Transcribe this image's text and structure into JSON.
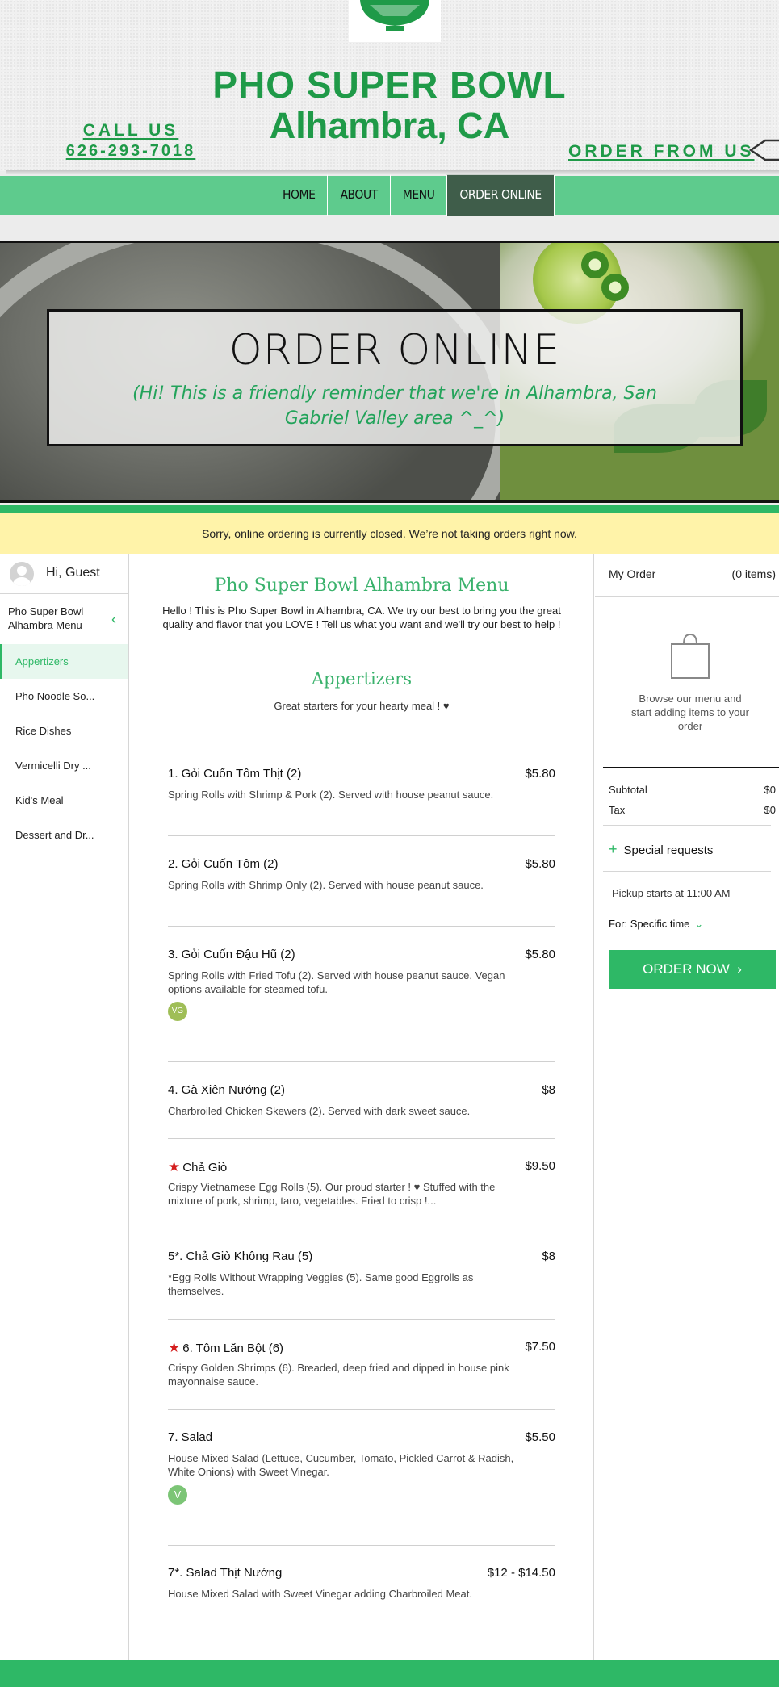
{
  "colors": {
    "brand_green": "#1f9a48",
    "nav_green": "#5ecb8d",
    "nav_active": "#3f5d4a",
    "accent": "#2eb866",
    "notice_bg": "#fff3a9",
    "star": "#d41e1e"
  },
  "header": {
    "title_line1": "PHO SUPER BOWL",
    "title_line2": "Alhambra, CA",
    "call_label": "CALL US",
    "phone": "626-293-7018",
    "order_from_label": "ORDER FROM US"
  },
  "nav": {
    "items": [
      {
        "label": "HOME"
      },
      {
        "label": "ABOUT"
      },
      {
        "label": "MENU"
      },
      {
        "label": "ORDER ONLINE"
      }
    ]
  },
  "hero": {
    "title": "ORDER ONLINE",
    "subtitle": "(Hi! This is a friendly reminder that we're in Alhambra, San Gabriel Valley area ^_^)"
  },
  "notice": "Sorry, online ordering is currently closed. We’re not taking orders right now.",
  "sidebar": {
    "greeting": "Hi, Guest",
    "menu_name": "Pho Super Bowl Alhambra Menu",
    "categories": [
      {
        "label": "Appertizers"
      },
      {
        "label": "Pho Noodle So..."
      },
      {
        "label": "Rice Dishes"
      },
      {
        "label": "Vermicelli Dry ..."
      },
      {
        "label": "Kid's Meal"
      },
      {
        "label": "Dessert and Dr..."
      }
    ]
  },
  "menu": {
    "title": "Pho Super Bowl Alhambra Menu",
    "intro": "Hello ! This is Pho Super Bowl in Alhambra, CA. We try our best to bring you the great quality and flavor that you LOVE ! Tell us what you want and we'll try our best to help !",
    "section_title": "Appertizers",
    "section_desc": "Great starters for your hearty meal ! ♥",
    "items": [
      {
        "name": "1. Gỏi Cuốn Tôm Thịt (2)",
        "price": "$5.80",
        "desc": "Spring Rolls with Shrimp & Pork (2). Served with house peanut sauce."
      },
      {
        "name": "2. Gỏi Cuốn Tôm (2)",
        "price": "$5.80",
        "desc": "Spring Rolls with Shrimp Only (2). Served with house peanut sauce."
      },
      {
        "name": "3. Gỏi Cuốn Đậu Hũ (2)",
        "price": "$5.80",
        "desc": "Spring Rolls with Fried Tofu (2). Served with house peanut sauce. Vegan options available for steamed tofu.",
        "badge": "VG"
      },
      {
        "name": "4. Gà Xiên Nướng (2)",
        "price": "$8",
        "desc": "Charbroiled Chicken Skewers (2). Served with dark sweet sauce."
      },
      {
        "name": "Chả Giò",
        "price": "$9.50",
        "desc": "Crispy Vietnamese Egg Rolls (5). Our proud starter ! ♥ Stuffed with the mixture of pork, shrimp, taro, vegetables. Fried to crisp !...",
        "starred": true
      },
      {
        "name": "5*. Chả Giò Không Rau (5)",
        "price": "$8",
        "desc": "*Egg Rolls Without Wrapping Veggies (5). Same good Eggrolls as themselves."
      },
      {
        "name": "6. Tôm Lăn Bột (6)",
        "price": "$7.50",
        "desc": "Crispy Golden Shrimps (6). Breaded, deep fried and dipped in house pink mayonnaise sauce.",
        "starred": true
      },
      {
        "name": "7. Salad",
        "price": "$5.50",
        "desc": "House Mixed Salad (Lettuce, Cucumber, Tomato, Pickled Carrot & Radish, White Onions) with Sweet Vinegar.",
        "badge": "V"
      },
      {
        "name": "7*. Salad Thịt Nướng",
        "price": "$12 - $14.50",
        "desc": "House Mixed Salad with Sweet Vinegar adding Charbroiled Meat."
      }
    ]
  },
  "cart": {
    "title": "My Order",
    "count": "(0 items)",
    "empty_text": "Browse our menu and start adding items to your order",
    "subtotal_label": "Subtotal",
    "subtotal_value": "$0",
    "tax_label": "Tax",
    "tax_value": "$0",
    "special_requests": "Special requests",
    "pickup": "Pickup starts at 11:00 AM",
    "time_option": "For: Specific time",
    "order_button": "ORDER NOW"
  }
}
